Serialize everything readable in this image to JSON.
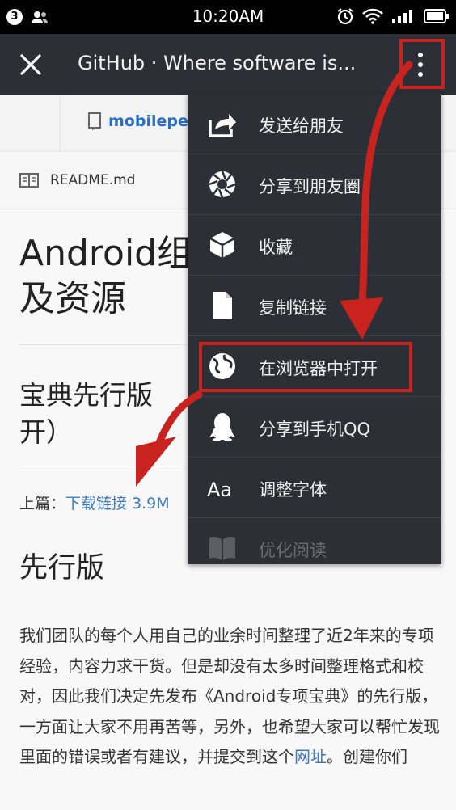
{
  "status_bar": {
    "notification_count": "3",
    "time": "10:20AM"
  },
  "title_bar": {
    "title": "GitHub · Where software is..."
  },
  "repo": {
    "link_text": "mobileper"
  },
  "readme": {
    "label": "README.md"
  },
  "article": {
    "h1_line1": "Android组",
    "h1_line2": "及资源",
    "h2_line1": "宝典先行版",
    "h2_line2": "开）",
    "prev_label": "上篇：",
    "prev_link": "下载链接 3.9M",
    "h3": "先行版",
    "para_part1": "我们团队的每个人用自己的业余时间整理了近2年来的专项经验，内容力求干货。但是却没有太多时间整理格式和校对，因此我们决定先发布《Android专项宝典》的先行版，一方面让大家不用再苦等，另外，也希望大家可以帮忙发现里面的错误或者有建议，并提交到这个",
    "para_link": "网址",
    "para_part2": "。创建你们"
  },
  "menu": {
    "items": [
      {
        "label": "发送给朋友",
        "icon": "share-icon"
      },
      {
        "label": "分享到朋友圈",
        "icon": "moments-icon"
      },
      {
        "label": "收藏",
        "icon": "favorite-cube-icon"
      },
      {
        "label": "复制链接",
        "icon": "copy-link-icon"
      },
      {
        "label": "在浏览器中打开",
        "icon": "globe-icon"
      },
      {
        "label": "分享到手机QQ",
        "icon": "qq-penguin-icon"
      },
      {
        "label": "调整字体",
        "icon": "font-size-icon"
      },
      {
        "label": "优化阅读",
        "icon": "book-icon"
      }
    ]
  },
  "colors": {
    "titlebar_bg": "#2c3036",
    "menu_bg": "#2c3036",
    "link_blue": "#3d78c2",
    "annotation_red": "#c8231e"
  }
}
